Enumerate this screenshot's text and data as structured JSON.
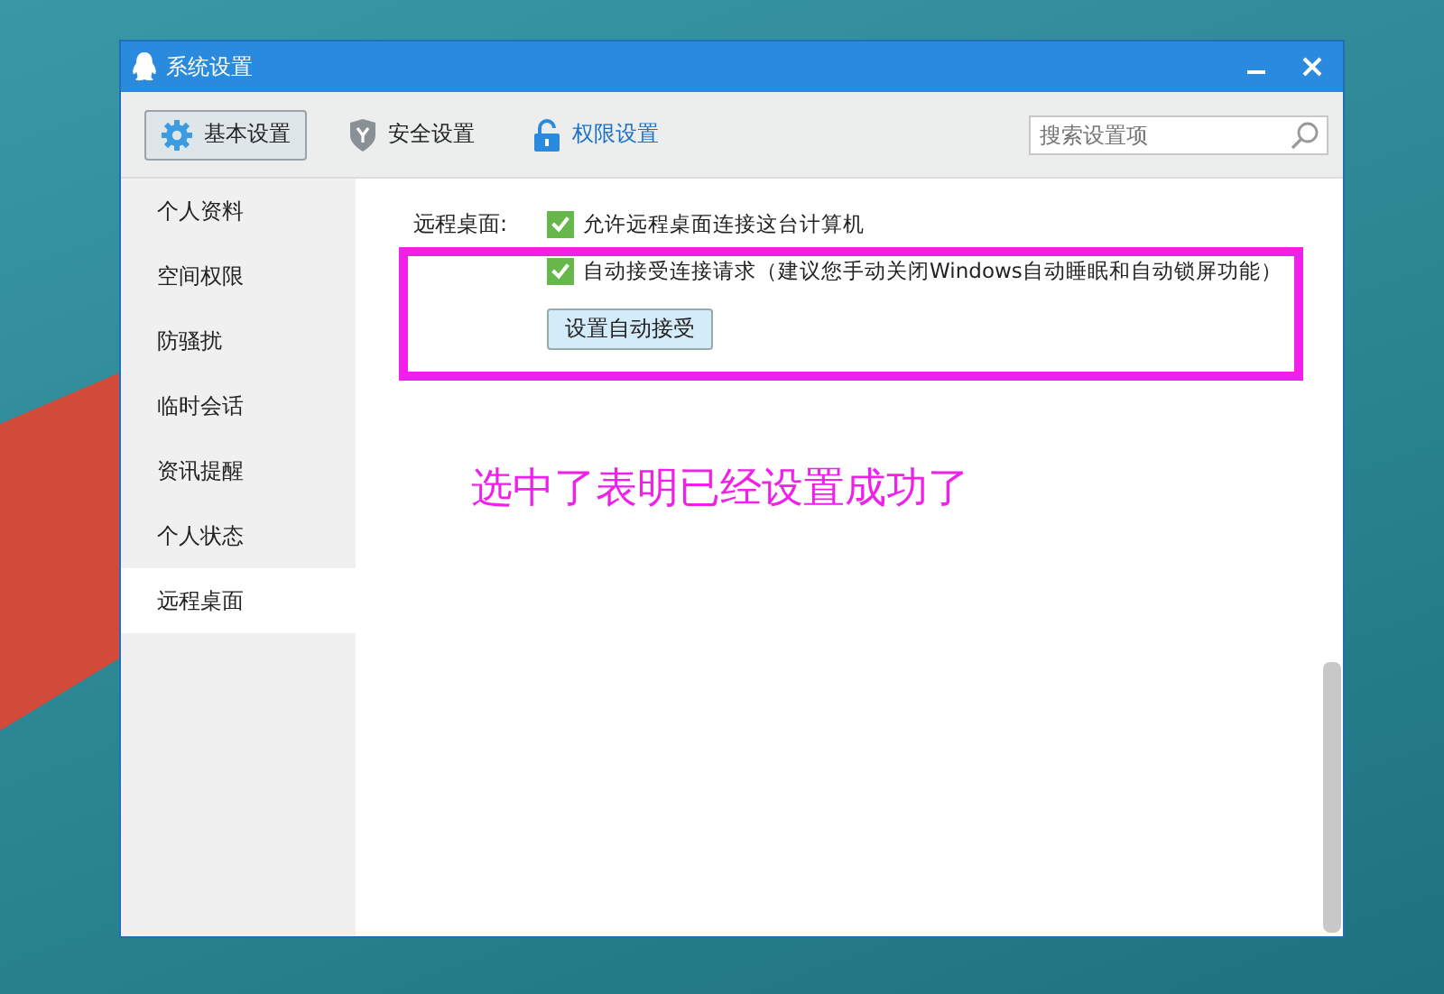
{
  "window": {
    "title": "系统设置"
  },
  "tabs": [
    {
      "label": "基本设置",
      "selected": true,
      "highlighted": false,
      "kind": "gear"
    },
    {
      "label": "安全设置",
      "selected": false,
      "highlighted": false,
      "kind": "shield"
    },
    {
      "label": "权限设置",
      "selected": false,
      "highlighted": true,
      "kind": "lock"
    }
  ],
  "search": {
    "placeholder": "搜索设置项"
  },
  "sidebar": {
    "items": [
      {
        "label": "个人资料",
        "selected": false
      },
      {
        "label": "空间权限",
        "selected": false
      },
      {
        "label": "防骚扰",
        "selected": false
      },
      {
        "label": "临时会话",
        "selected": false
      },
      {
        "label": "资讯提醒",
        "selected": false
      },
      {
        "label": "个人状态",
        "selected": false
      },
      {
        "label": "远程桌面",
        "selected": true
      }
    ]
  },
  "section": {
    "label": "远程桌面:",
    "options": [
      {
        "label": "允许远程桌面连接这台计算机",
        "checked": true
      },
      {
        "label": "自动接受连接请求（建议您手动关闭Windows自动睡眠和自动锁屏功能）",
        "checked": true
      }
    ],
    "button": "设置自动接受"
  },
  "annotation": {
    "text": "选中了表明已经设置成功了"
  }
}
